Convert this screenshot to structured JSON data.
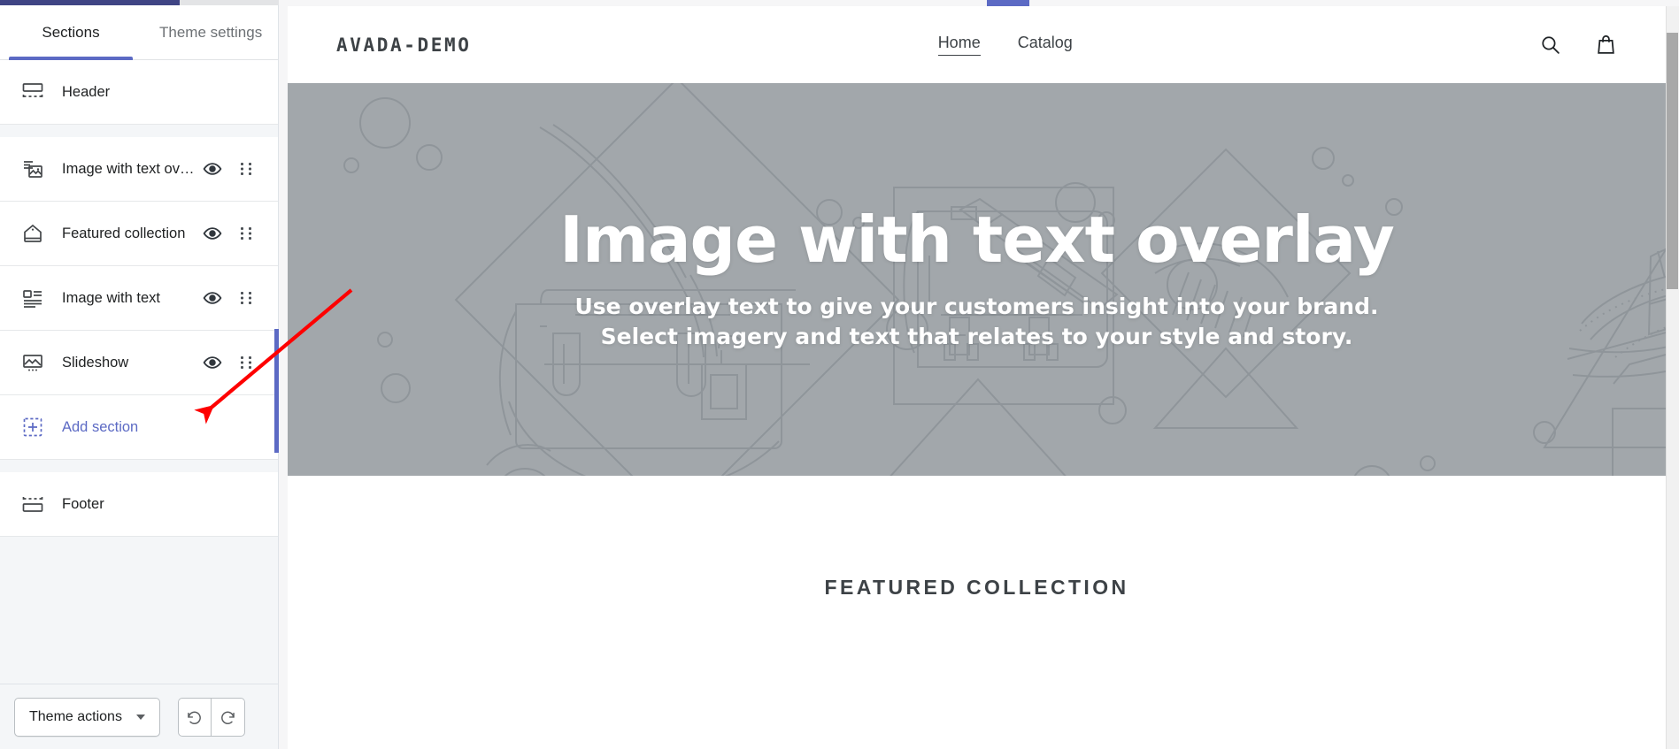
{
  "sidebar": {
    "tabs": [
      {
        "label": "Sections",
        "active": true
      },
      {
        "label": "Theme settings",
        "active": false
      }
    ],
    "sections": [
      {
        "label": "Header",
        "icon": "header-icon",
        "eye": false,
        "grip": false
      },
      {
        "label": "Image with text ov…",
        "icon": "image-with-text-overlay-icon",
        "eye": true,
        "grip": true
      },
      {
        "label": "Featured collection",
        "icon": "featured-collection-icon",
        "eye": true,
        "grip": true
      },
      {
        "label": "Image with text",
        "icon": "image-with-text-icon",
        "eye": true,
        "grip": true
      },
      {
        "label": "Slideshow",
        "icon": "slideshow-icon",
        "eye": true,
        "grip": true
      },
      {
        "label": "Add section",
        "icon": "add-section-icon",
        "eye": false,
        "grip": false
      }
    ],
    "footer_section": {
      "label": "Footer",
      "icon": "footer-icon"
    },
    "footer": {
      "theme_actions_label": "Theme actions",
      "undo_label": "Undo",
      "redo_label": "Redo"
    }
  },
  "preview": {
    "store_header": {
      "logo": "AVADA-DEMO",
      "nav": [
        {
          "label": "Home",
          "active": true
        },
        {
          "label": "Catalog",
          "active": false
        }
      ],
      "search_icon": "search-icon",
      "cart_icon": "shopping-bag-icon"
    },
    "hero": {
      "heading": "Image with text overlay",
      "subline1": "Use overlay text to give your customers insight into your brand.",
      "subline2": "Select imagery and text that relates to your style and story."
    },
    "featured": {
      "title": "FEATURED COLLECTION"
    }
  },
  "colors": {
    "accent": "#5c6ac4",
    "navy": "#3f4484",
    "hero_bg": "#a2a7ab",
    "annotation": "#fe0000"
  }
}
